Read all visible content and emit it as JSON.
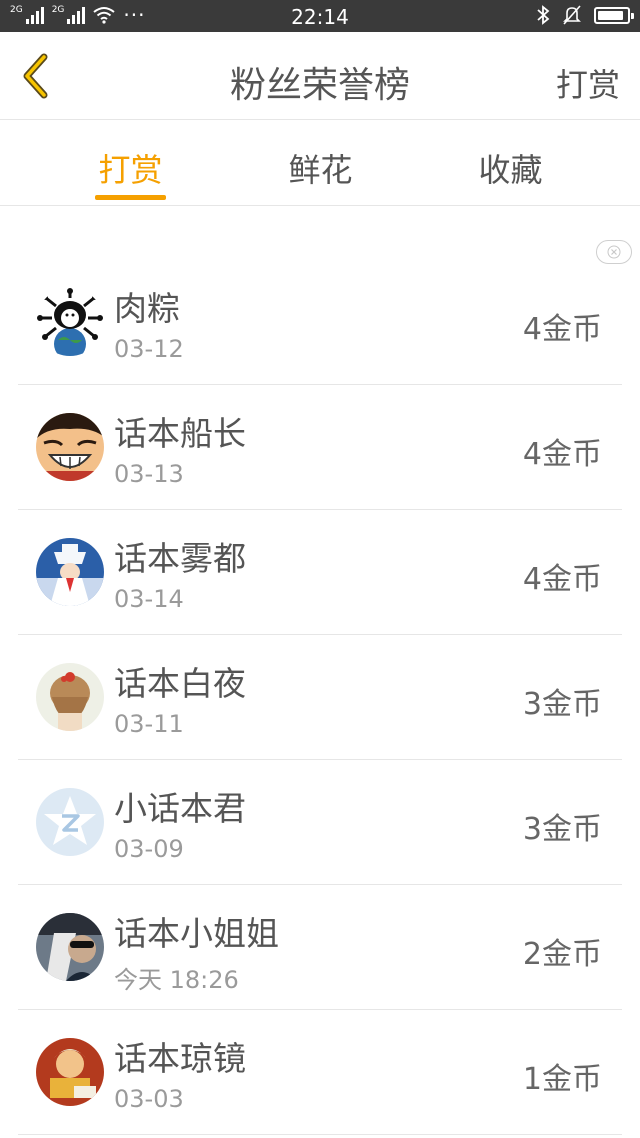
{
  "status_bar": {
    "network_1": "2G",
    "network_2": "2G",
    "more": "···",
    "time": "22:14",
    "battery_level": 0.9,
    "icons": [
      "bluetooth-icon",
      "silent-icon",
      "battery-icon"
    ]
  },
  "header": {
    "back_icon": "chevron-left-icon",
    "title": "粉丝荣誉榜",
    "action": "打赏"
  },
  "tabs": [
    {
      "label": "打赏",
      "active": true
    },
    {
      "label": "鲜花",
      "active": false
    },
    {
      "label": "收藏",
      "active": false
    }
  ],
  "close_icon": "close-icon",
  "list": [
    {
      "name": "肉粽",
      "date": "03-12",
      "amount": "4金币"
    },
    {
      "name": "话本船长",
      "date": "03-13",
      "amount": "4金币"
    },
    {
      "name": "话本雾都",
      "date": "03-14",
      "amount": "4金币"
    },
    {
      "name": "话本白夜",
      "date": "03-11",
      "amount": "3金币"
    },
    {
      "name": "小话本君",
      "date": "03-09",
      "amount": "3金币"
    },
    {
      "name": "话本小姐姐",
      "date": "今天 18:26",
      "amount": "2金币"
    },
    {
      "name": "话本琼镜",
      "date": "03-03",
      "amount": "1金币"
    }
  ],
  "colors": {
    "accent": "#f5a000",
    "status_bar": "#3a3a3a",
    "divider": "#e6e6e6",
    "text": "#555555",
    "subtext": "#9a9a9a"
  }
}
